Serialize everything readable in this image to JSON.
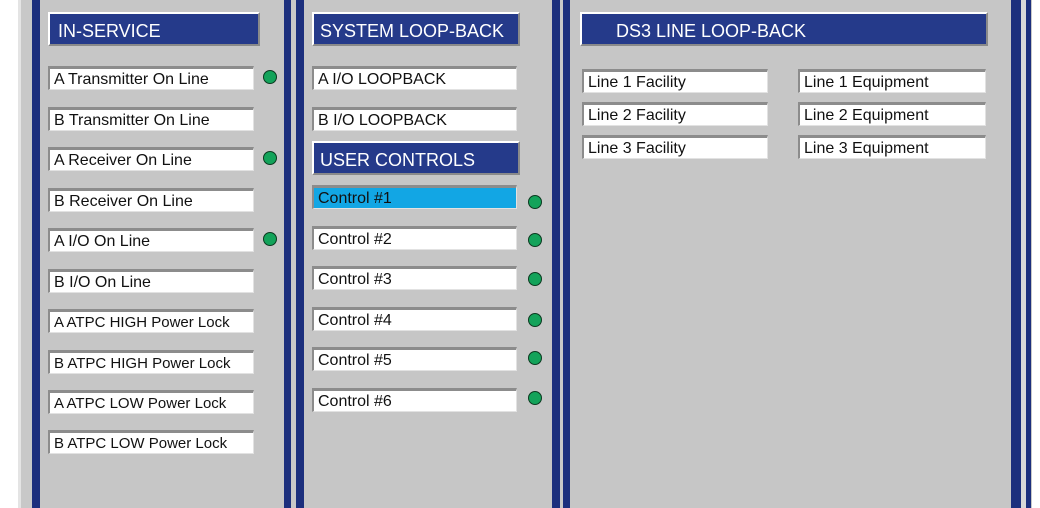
{
  "colors": {
    "panel_bg": "#c6c6c6",
    "rail": "#1c2f7d",
    "header_bg": "#253a8a",
    "selected_bg": "#12a6e4",
    "led_on": "#13a35a"
  },
  "in_service": {
    "title": "IN-SERVICE",
    "items": [
      {
        "label": "A Transmitter On Line",
        "led": "on"
      },
      {
        "label": "B Transmitter On Line",
        "led": "off"
      },
      {
        "label": "A Receiver On Line",
        "led": "on"
      },
      {
        "label": "B Receiver On Line",
        "led": "off"
      },
      {
        "label": "A I/O On Line",
        "led": "on"
      },
      {
        "label": "B I/O On Line",
        "led": "off"
      },
      {
        "label": "A ATPC HIGH Power Lock",
        "led": "off"
      },
      {
        "label": "B ATPC HIGH Power Lock",
        "led": "off"
      },
      {
        "label": "A ATPC LOW Power Lock",
        "led": "off"
      },
      {
        "label": "B ATPC LOW Power Lock",
        "led": "off"
      }
    ]
  },
  "system_loopback": {
    "title": "SYSTEM LOOP-BACK",
    "items": [
      {
        "label": "A I/O LOOPBACK"
      },
      {
        "label": "B I/O LOOPBACK"
      }
    ]
  },
  "user_controls": {
    "title": "USER CONTROLS",
    "items": [
      {
        "label": "Control #1",
        "selected": true,
        "led": "on"
      },
      {
        "label": "Control #2",
        "selected": false,
        "led": "on"
      },
      {
        "label": "Control #3",
        "selected": false,
        "led": "on"
      },
      {
        "label": "Control #4",
        "selected": false,
        "led": "on"
      },
      {
        "label": "Control #5",
        "selected": false,
        "led": "on"
      },
      {
        "label": "Control #6",
        "selected": false,
        "led": "on"
      }
    ]
  },
  "ds3_loopback": {
    "title": "DS3 LINE LOOP-BACK",
    "facility": [
      {
        "label": "Line 1 Facility"
      },
      {
        "label": "Line 2 Facility"
      },
      {
        "label": "Line 3 Facility"
      }
    ],
    "equipment": [
      {
        "label": "Line 1 Equipment"
      },
      {
        "label": "Line 2 Equipment"
      },
      {
        "label": "Line 3 Equipment"
      }
    ]
  }
}
